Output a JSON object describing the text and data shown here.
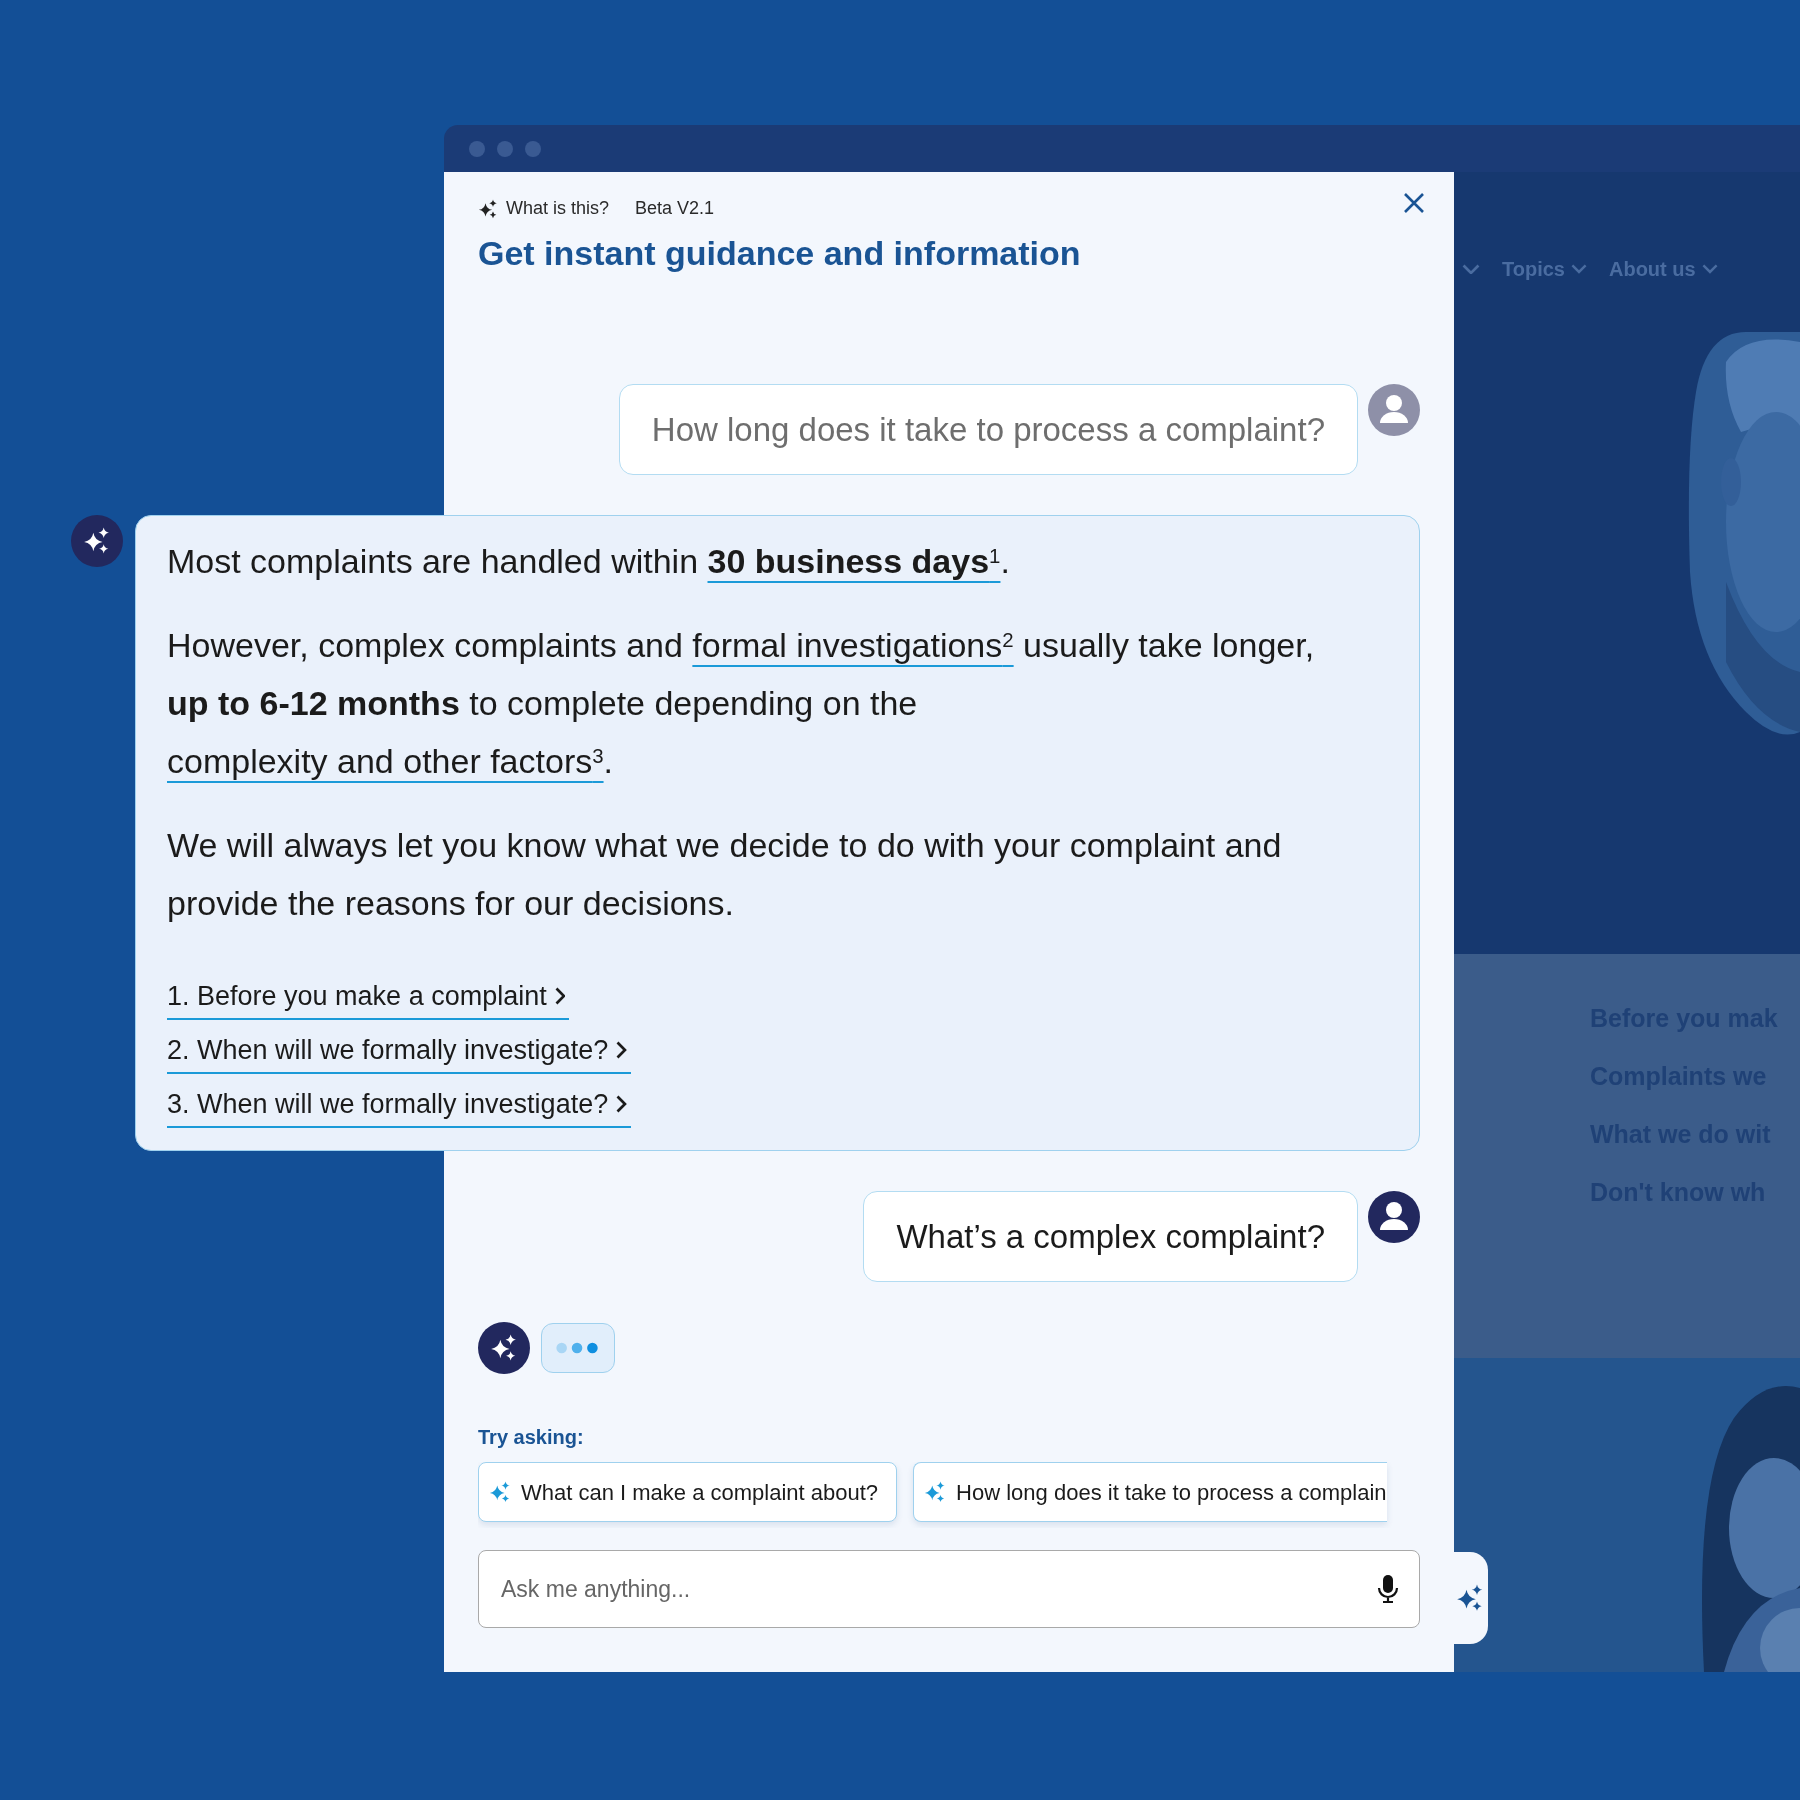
{
  "site_background": {
    "nav": [
      {
        "label": "Topics"
      },
      {
        "label": "About us"
      }
    ],
    "section_links": [
      "Before you mak",
      "Complaints we",
      "What we do wit",
      "Don't know wh"
    ]
  },
  "chat_panel": {
    "header": {
      "info_link": "What is this?",
      "version": "Beta V2.1",
      "title": "Get instant guidance and information"
    },
    "messages": [
      {
        "kind": "user",
        "text": "How long does it take to process a complaint?",
        "faded": true
      },
      {
        "kind": "answer",
        "paragraphs": [
          [
            {
              "text": "Most complaints are handled within "
            },
            {
              "text": "30 business days",
              "bold": true,
              "link": true,
              "note": "1"
            },
            {
              "text": "."
            }
          ],
          [
            {
              "text": "However, complex complaints and "
            },
            {
              "text": "formal investigations",
              "link": true,
              "note": "2"
            },
            {
              "text": " usually take longer, "
            },
            {
              "text": "up to 6-12 months",
              "bold": true
            },
            {
              "text": " to complete depending on the "
            },
            {
              "text": "complexity and other factors",
              "link": true,
              "note": "3"
            },
            {
              "text": "."
            }
          ],
          [
            {
              "text": "We will always let you know what we decide to do with your complaint and provide the reasons for our decisions."
            }
          ]
        ],
        "sources": [
          "1. Before you make a complaint",
          "2. When will we formally investigate?",
          "3. When will we formally investigate?"
        ]
      },
      {
        "kind": "user",
        "text": "What’s a complex complaint?",
        "faded": false
      },
      {
        "kind": "typing"
      }
    ],
    "try_asking": {
      "label": "Try asking:",
      "suggestions": [
        "What can I make a complaint about?",
        "How long does it take to process a complain"
      ]
    },
    "input": {
      "placeholder": "Ask me anything..."
    }
  }
}
